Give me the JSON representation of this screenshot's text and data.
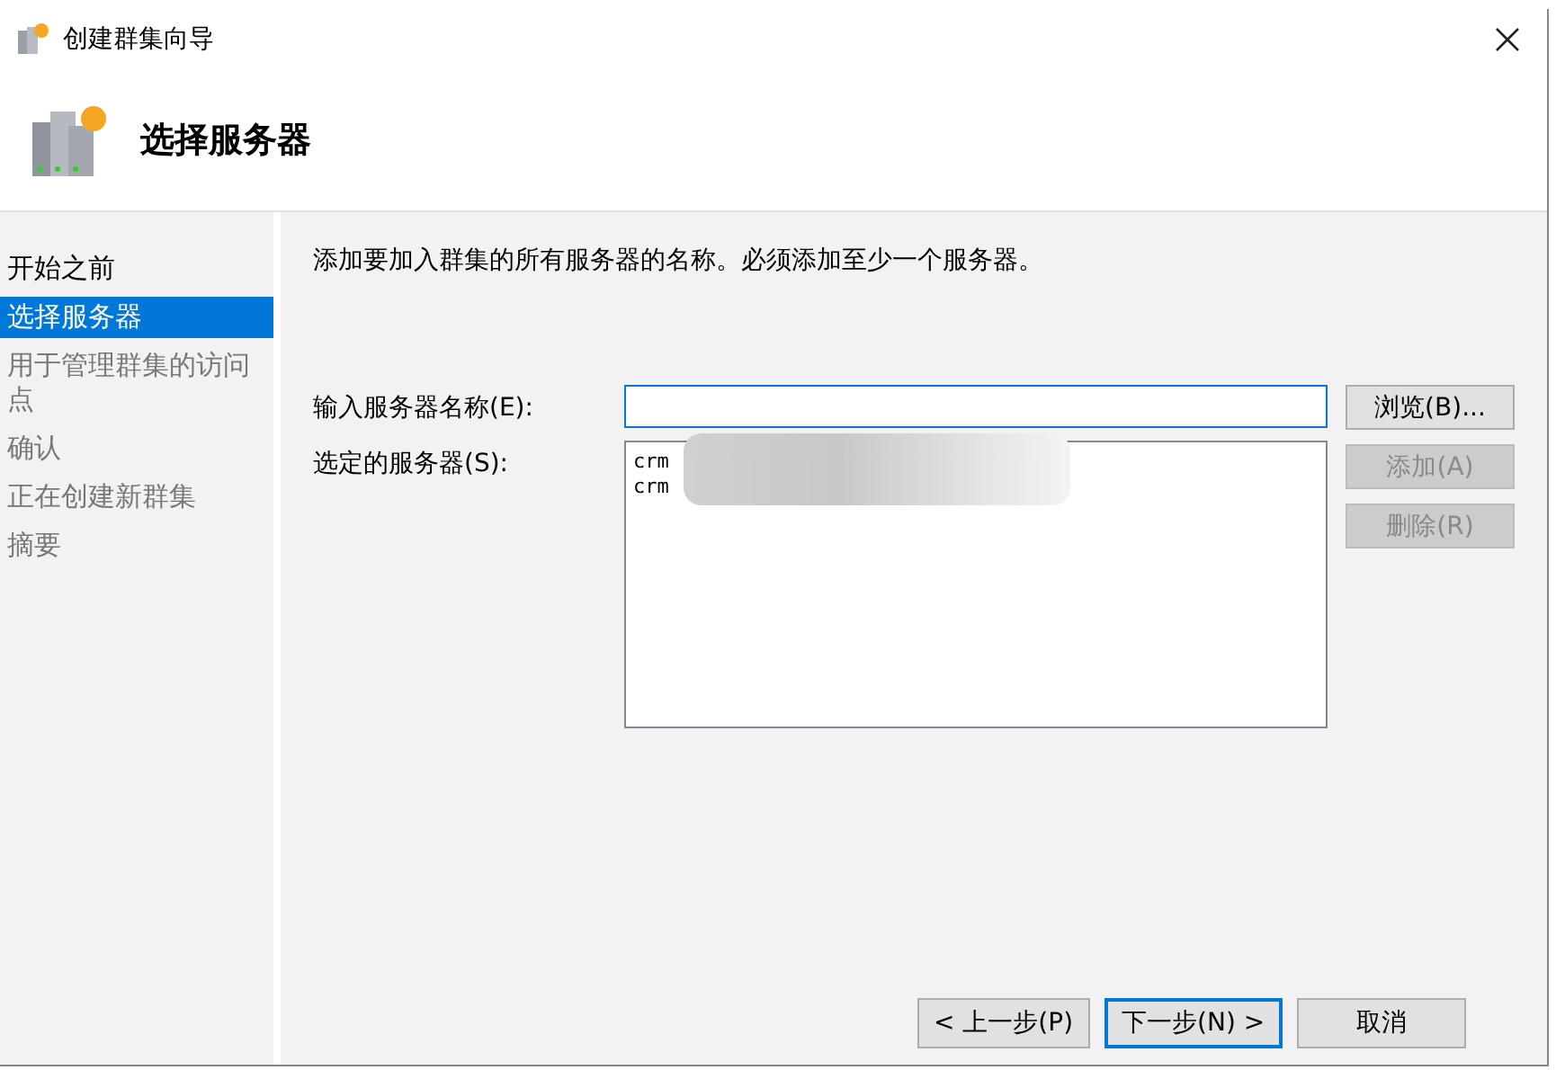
{
  "window": {
    "title": "创建群集向导"
  },
  "header": {
    "heading": "选择服务器"
  },
  "steps": [
    {
      "label": "开始之前",
      "selected": false,
      "disabled": false
    },
    {
      "label": "选择服务器",
      "selected": true,
      "disabled": false
    },
    {
      "label": "用于管理群集的访问点",
      "selected": false,
      "disabled": true
    },
    {
      "label": "确认",
      "selected": false,
      "disabled": true
    },
    {
      "label": "正在创建新群集",
      "selected": false,
      "disabled": true
    },
    {
      "label": "摘要",
      "selected": false,
      "disabled": true
    }
  ],
  "instruction": "添加要加入群集的所有服务器的名称。必须添加至少一个服务器。",
  "server_name": {
    "label": "输入服务器名称(E):"
  },
  "selected_servers": {
    "label": "选定的服务器(S):",
    "items": [
      "crm",
      "crm"
    ]
  },
  "side_buttons": [
    {
      "label": "浏览(B)...",
      "disabled": false
    },
    {
      "label": "添加(A)",
      "disabled": true
    },
    {
      "label": "删除(R)",
      "disabled": true
    }
  ],
  "footer_buttons": [
    {
      "label": "< 上一步(P)",
      "default": false
    },
    {
      "label": "下一步(N) >",
      "default": true
    },
    {
      "label": "取消",
      "default": false
    }
  ]
}
